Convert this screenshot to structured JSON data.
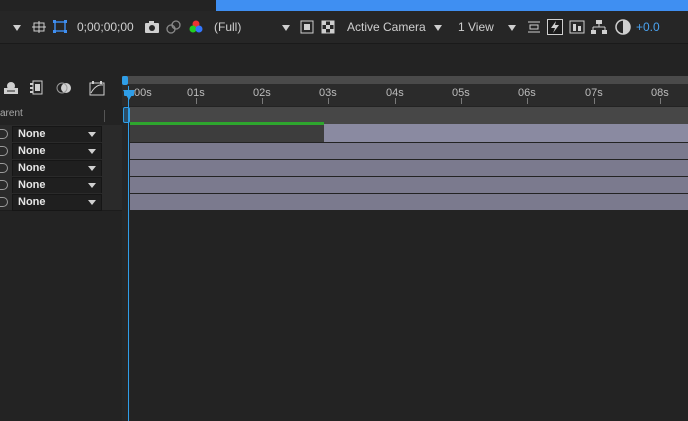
{
  "toolbar": {
    "timecode": "0;00;00;00",
    "resolution": "(Full)",
    "camera": "Active Camera",
    "view": "1 View",
    "exposure": "+0.0"
  },
  "timeline": {
    "parent_header": "arent",
    "ticks": [
      "00s",
      "01s",
      "02s",
      "03s",
      "04s",
      "05s",
      "06s",
      "07s",
      "08s"
    ],
    "layers": [
      {
        "parent": "None"
      },
      {
        "parent": "None"
      },
      {
        "parent": "None"
      },
      {
        "parent": "None"
      },
      {
        "parent": "None"
      }
    ]
  },
  "colors": {
    "accent": "#2f9ee8",
    "tab_highlight": "#3f8ff2",
    "layer_bar": "#7b7a8e",
    "green_bar": "#2ea62e"
  }
}
